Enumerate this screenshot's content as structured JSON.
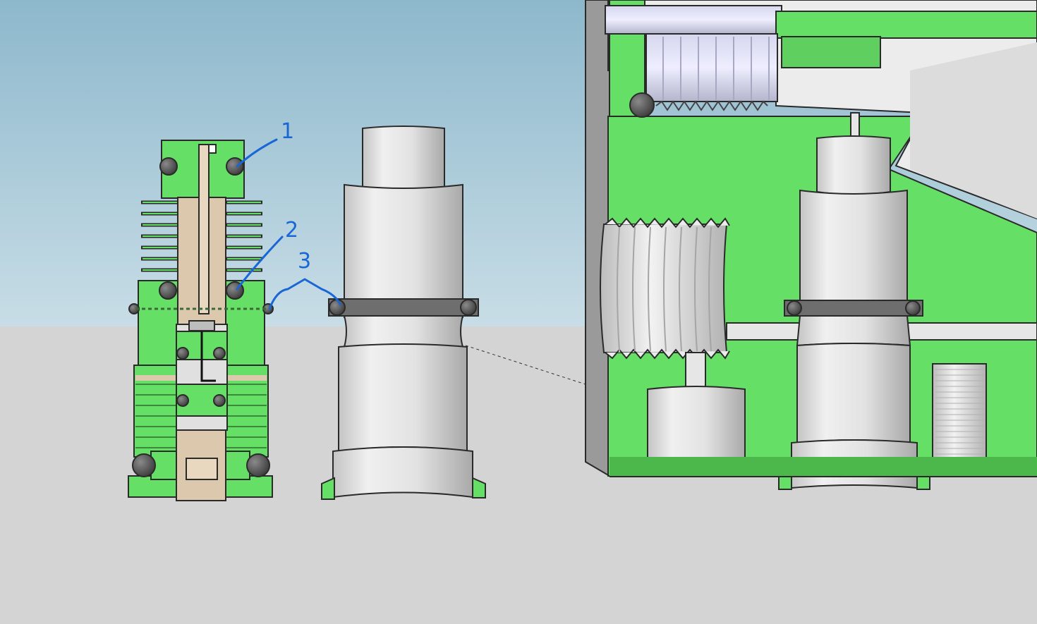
{
  "callouts": [
    {
      "id": "1",
      "label": "1"
    },
    {
      "id": "2",
      "label": "2"
    },
    {
      "id": "3",
      "label": "3"
    }
  ],
  "colors": {
    "sky_top": "#8db8cc",
    "sky_bottom": "#c8dde6",
    "ground": "#d4d4d4",
    "part_green": "#66df66",
    "part_green_dark": "#4cb84c",
    "cavity_gray": "#e6e6e6",
    "oring_gray": "#6e6e6e",
    "core_tan": "#dcc8ac",
    "callout_blue": "#1a66d6",
    "outline": "#2a2a2a"
  }
}
